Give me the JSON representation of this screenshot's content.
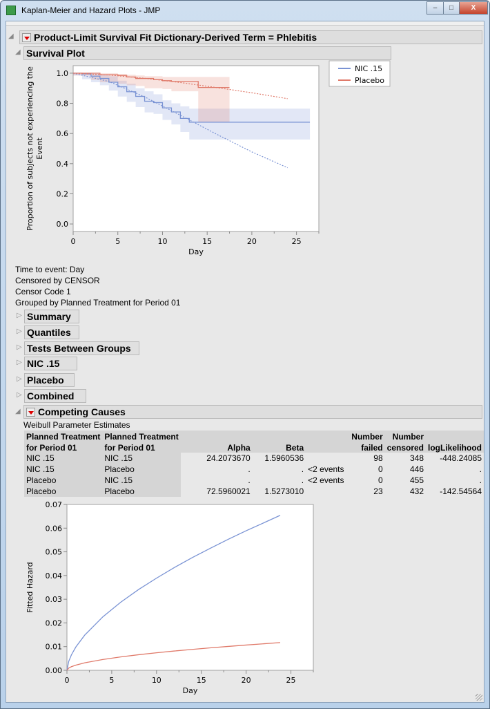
{
  "window": {
    "title": "Kaplan-Meier and Hazard Plots - JMP",
    "controls": [
      "minimize",
      "maximize",
      "close"
    ]
  },
  "report": {
    "main_header": "Product-Limit Survival Fit Dictionary-Derived Term = Phlebitis",
    "survival_plot_header": "Survival Plot",
    "info": [
      "Time to event:  Day",
      "Censored by  CENSOR",
      "Censor Code  1",
      "Grouped by  Planned Treatment for Period 01"
    ],
    "collapsed_sections": [
      "Summary",
      "Quantiles",
      "Tests Between Groups",
      "NIC .15",
      "Placebo",
      "Combined"
    ],
    "competing_header": "Competing Causes",
    "weibull_title": "Weibull Parameter Estimates",
    "table": {
      "headers": [
        [
          "Planned Treatment",
          "for Period 01"
        ],
        [
          "Planned Treatment",
          "for Period 01"
        ],
        [
          "",
          "Alpha"
        ],
        [
          "",
          "Beta"
        ],
        [
          "",
          ""
        ],
        [
          "Number",
          "failed"
        ],
        [
          "Number",
          "censored"
        ],
        [
          "",
          "logLikelihood"
        ]
      ],
      "rows": [
        [
          "NIC .15",
          "NIC .15",
          "24.2073670",
          "1.5960536",
          "",
          "98",
          "348",
          "-448.24085"
        ],
        [
          "NIC .15",
          "Placebo",
          ".",
          ".",
          "<2 events",
          "0",
          "446",
          "."
        ],
        [
          "Placebo",
          "NIC .15",
          ".",
          ".",
          "<2 events",
          "0",
          "455",
          "."
        ],
        [
          "Placebo",
          "Placebo",
          "72.5960021",
          "1.5273010",
          "",
          "23",
          "432",
          "-142.54564"
        ]
      ]
    }
  },
  "chart_data": [
    {
      "type": "line",
      "subtype": "kaplan-meier step with confidence bands and Weibull fit",
      "xlabel": "Day",
      "ylabel": "Proportion of subjects not experiencing the Event",
      "xlim": [
        0,
        27.5
      ],
      "ylim": [
        -0.05,
        1.05
      ],
      "xticks": [
        "0",
        "5",
        "10",
        "15",
        "20",
        "25"
      ],
      "yticks": [
        "0.0",
        "0.2",
        "0.4",
        "0.6",
        "0.8",
        "1.0"
      ],
      "legend": {
        "position": "right",
        "entries": [
          "NIC .15",
          "Placebo"
        ]
      },
      "series": [
        {
          "name": "NIC .15",
          "color": "#7a93d4",
          "steps": [
            [
              0,
              1,
              1.0
            ],
            [
              1,
              2,
              0.995
            ],
            [
              2,
              3,
              0.98
            ],
            [
              3,
              4,
              0.965
            ],
            [
              4,
              5,
              0.94
            ],
            [
              5,
              6,
              0.91
            ],
            [
              6,
              7,
              0.877
            ],
            [
              7,
              8,
              0.846
            ],
            [
              8,
              9,
              0.814
            ],
            [
              9,
              10,
              0.805
            ],
            [
              10,
              11,
              0.77
            ],
            [
              11,
              12,
              0.743
            ],
            [
              12,
              13,
              0.7
            ],
            [
              13,
              26.5,
              0.675
            ]
          ],
          "band": [
            [
              0,
              1,
              0.985,
              1.0
            ],
            [
              1,
              2,
              0.96,
              1.0
            ],
            [
              2,
              3,
              0.94,
              1.0
            ],
            [
              3,
              4,
              0.92,
              0.99
            ],
            [
              4,
              5,
              0.885,
              0.98
            ],
            [
              5,
              6,
              0.845,
              0.95
            ],
            [
              6,
              7,
              0.81,
              0.93
            ],
            [
              7,
              8,
              0.775,
              0.9
            ],
            [
              8,
              9,
              0.74,
              0.88
            ],
            [
              9,
              10,
              0.73,
              0.86
            ],
            [
              10,
              11,
              0.69,
              0.82
            ],
            [
              11,
              12,
              0.66,
              0.8
            ],
            [
              12,
              13,
              0.61,
              0.78
            ],
            [
              13,
              26.5,
              0.56,
              0.765
            ]
          ],
          "weibull_fit": [
            [
              0,
              1.0
            ],
            [
              4,
              0.945
            ],
            [
              8,
              0.843
            ],
            [
              12,
              0.721
            ],
            [
              16,
              0.597
            ],
            [
              20,
              0.478
            ],
            [
              24,
              0.373
            ]
          ]
        },
        {
          "name": "Placebo",
          "color": "#e07a6a",
          "steps": [
            [
              0,
              3,
              1.0
            ],
            [
              3,
              5,
              0.99
            ],
            [
              5,
              6,
              0.985
            ],
            [
              6,
              7,
              0.975
            ],
            [
              7,
              9,
              0.965
            ],
            [
              9,
              10,
              0.957
            ],
            [
              10,
              11,
              0.95
            ],
            [
              11,
              14,
              0.945
            ],
            [
              14,
              17.5,
              0.905
            ]
          ],
          "band": [
            [
              0,
              2,
              0.985,
              1.0
            ],
            [
              2,
              3,
              0.955,
              1.0
            ],
            [
              3,
              5,
              0.94,
              1.0
            ],
            [
              5,
              6,
              0.93,
              0.995
            ],
            [
              6,
              7,
              0.92,
              0.99
            ],
            [
              7,
              8,
              0.915,
              0.985
            ],
            [
              8,
              10,
              0.9,
              0.98
            ],
            [
              10,
              11,
              0.895,
              0.975
            ],
            [
              11,
              14,
              0.88,
              0.975
            ],
            [
              14,
              17.5,
              0.675,
              0.975
            ]
          ],
          "weibull_fit": [
            [
              0,
              1.0
            ],
            [
              4,
              0.988
            ],
            [
              8,
              0.966
            ],
            [
              12,
              0.938
            ],
            [
              16,
              0.905
            ],
            [
              20,
              0.87
            ],
            [
              24,
              0.831
            ]
          ]
        }
      ]
    },
    {
      "type": "line",
      "xlabel": "Day",
      "ylabel": "Fitted Hazard",
      "xlim": [
        0,
        27.5
      ],
      "ylim": [
        0,
        0.07
      ],
      "xticks": [
        "0",
        "5",
        "10",
        "15",
        "20",
        "25"
      ],
      "yticks": [
        "0.00",
        "0.01",
        "0.02",
        "0.03",
        "0.04",
        "0.05",
        "0.06",
        "0.07"
      ],
      "series": [
        {
          "name": "NIC .15",
          "color": "#7a93d4",
          "points": [
            [
              0,
              0
            ],
            [
              0.2,
              0.00378
            ],
            [
              0.5,
              0.00653
            ],
            [
              1,
              0.00987
            ],
            [
              2,
              0.01492
            ],
            [
              4,
              0.02255
            ],
            [
              6,
              0.02872
            ],
            [
              8,
              0.0341
            ],
            [
              10,
              0.0389
            ],
            [
              12,
              0.0434
            ],
            [
              14,
              0.0476
            ],
            [
              16,
              0.0515
            ],
            [
              18,
              0.0553
            ],
            [
              20,
              0.0589
            ],
            [
              22,
              0.0623
            ],
            [
              23.8,
              0.0654
            ]
          ]
        },
        {
          "name": "Placebo",
          "color": "#e07a6a",
          "points": [
            [
              0,
              0
            ],
            [
              0.2,
              0.00094
            ],
            [
              0.5,
              0.00153
            ],
            [
              1,
              0.0022
            ],
            [
              2,
              0.00317
            ],
            [
              4,
              0.00456
            ],
            [
              6,
              0.00565
            ],
            [
              8,
              0.00658
            ],
            [
              10,
              0.0074
            ],
            [
              12,
              0.00815
            ],
            [
              14,
              0.00883
            ],
            [
              16,
              0.00948
            ],
            [
              18,
              0.01008
            ],
            [
              20,
              0.01066
            ],
            [
              22,
              0.01121
            ],
            [
              23.8,
              0.0117
            ]
          ]
        }
      ]
    }
  ]
}
